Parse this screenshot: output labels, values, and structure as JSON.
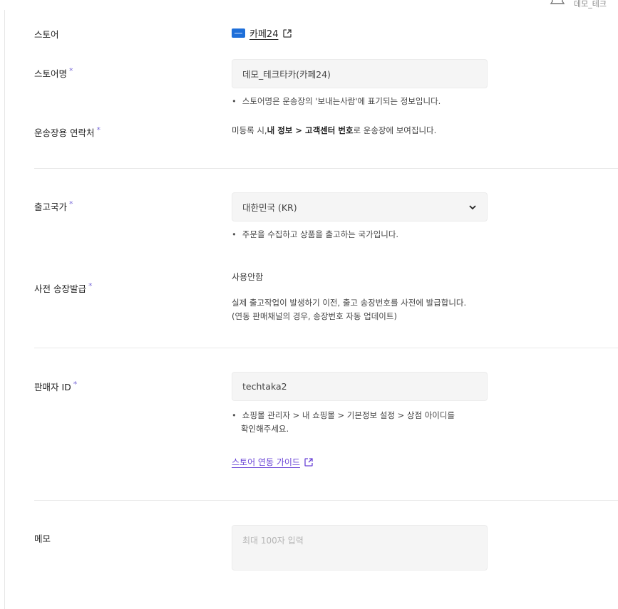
{
  "header": {
    "user": "데모_테크"
  },
  "form": {
    "store": {
      "label": "스토어",
      "name": "카페24"
    },
    "store_name": {
      "label": "스토어명",
      "value": "데모_테크타카(카페24)",
      "hint": "스토어명은 운송장의 '보내는사람'에 표기되는 정보입니다."
    },
    "contact": {
      "label": "운송장용 연락처",
      "text_1": "미등록 시,",
      "text_bold": "내 정보 > 고객센터 번호",
      "text_2": "로 운송장에 보여집니다."
    },
    "country": {
      "label": "출고국가",
      "value": "대한민국 (KR)",
      "hint": "주문을 수집하고 상품을 출고하는 국가입니다."
    },
    "pre_invoice": {
      "label": "사전 송장발급",
      "status": "사용안함",
      "desc_1": "실제 출고작업이 발생하기 이전, 출고 송장번호를 사전에 발급합니다.",
      "desc_2": "(연동 판매채널의 경우, 송장번호 자동 업데이트)"
    },
    "seller_id": {
      "label": "판매자 ID",
      "value": "techtaka2",
      "hint_1": "쇼핑몰 관리자 > 내 쇼핑몰 > 기본정보 설정 > 상점 아이디를",
      "hint_2": "확인해주세요.",
      "guide": "스토어 연동 가이드"
    },
    "memo": {
      "label": "메모",
      "placeholder": "최대 100자 입력"
    },
    "required_mark": "*",
    "bullet": "•"
  },
  "colors": {
    "accent": "#6b45d6",
    "required": "#7a6bd8",
    "store_logo": "#1e6fd9"
  }
}
